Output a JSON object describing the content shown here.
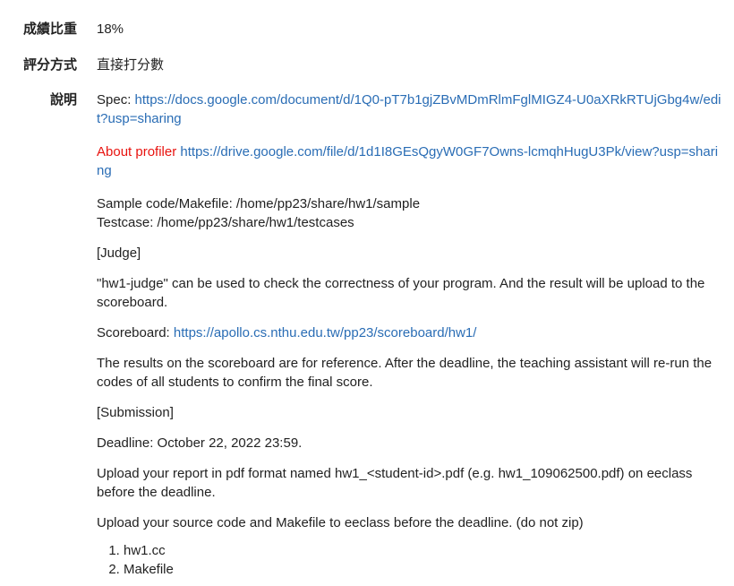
{
  "fields": {
    "weight_label": "成績比重",
    "weight_value": "18%",
    "grading_label": "評分方式",
    "grading_value": "直接打分數",
    "desc_label": "說明"
  },
  "description": {
    "spec_prefix": "Spec: ",
    "spec_url": "https://docs.google.com/document/d/1Q0-pT7b1gjZBvMDmRlmFglMIGZ4-U0aXRkRTUjGbg4w/edit?usp=sharing",
    "profiler_label": "About profiler",
    "profiler_url": "https://drive.google.com/file/d/1d1I8GEsQgyW0GF7Owns-lcmqhHugU3Pk/view?usp=sharing",
    "sample_code": "Sample code/Makefile: /home/pp23/share/hw1/sample",
    "testcase": "Testcase: /home/pp23/share/hw1/testcases",
    "judge_heading": "[Judge]",
    "judge_text": "\"hw1-judge\" can be used to check the correctness of your program. And the result will be upload to the scoreboard.",
    "scoreboard_prefix": "Scoreboard: ",
    "scoreboard_url": "https://apollo.cs.nthu.edu.tw/pp23/scoreboard/hw1/",
    "results_text": "The results on the scoreboard are for reference. After the deadline, the teaching assistant will re-run the codes of all students to confirm the final score.",
    "submission_heading": "[Submission]",
    "deadline": "Deadline: October 22, 2022 23:59.",
    "report_text": "Upload your report in pdf format named hw1_<student-id>.pdf (e.g. hw1_109062500.pdf) on eeclass before the deadline.",
    "source_text": "Upload your source code and Makefile to eeclass before the deadline. (do not zip)",
    "files": [
      "hw1.cc",
      "Makefile"
    ]
  },
  "colors": {
    "link": "#2a6db5",
    "highlight": "#e8130f",
    "text": "#222222"
  }
}
